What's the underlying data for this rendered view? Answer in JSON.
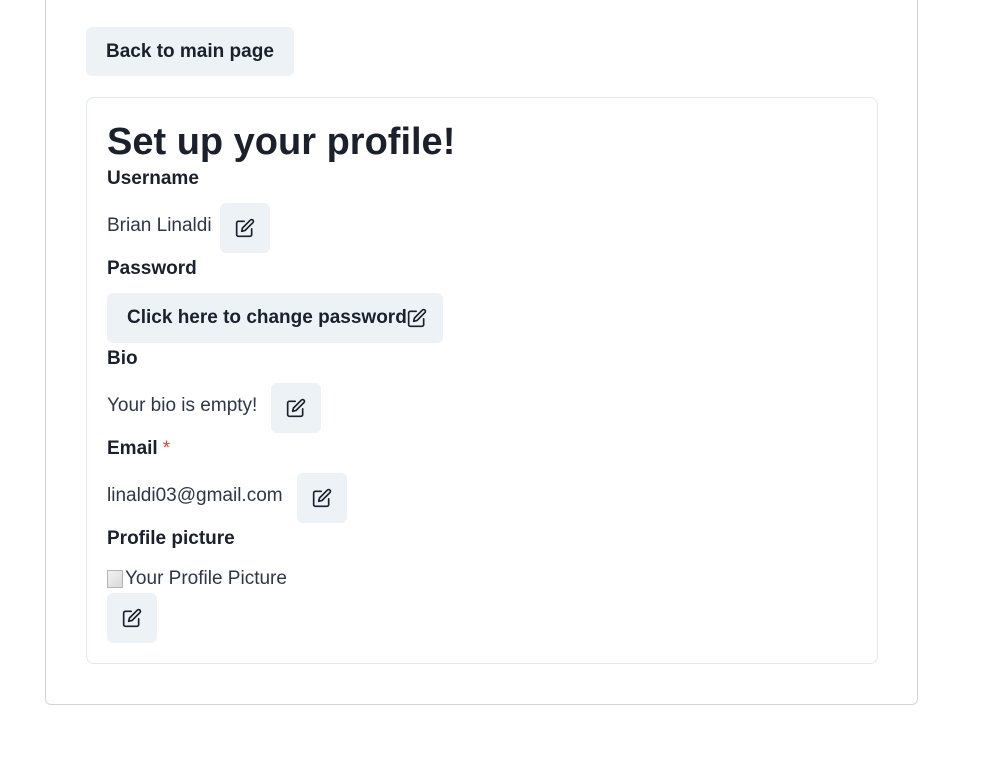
{
  "header": {
    "back_label": "Back to main page"
  },
  "profile": {
    "title": "Set up your profile!",
    "username": {
      "label": "Username",
      "value": "Brian Linaldi"
    },
    "password": {
      "label": "Password",
      "button_label": "Click here to change password"
    },
    "bio": {
      "label": "Bio",
      "value": "Your bio is empty!"
    },
    "email": {
      "label": "Email",
      "required_mark": "*",
      "value": "linaldi03@gmail.com"
    },
    "picture": {
      "label": "Profile picture",
      "alt": "Your Profile Picture"
    }
  },
  "icons": {
    "edit": "edit-icon"
  },
  "colors": {
    "button_bg": "#edf2f7",
    "text": "#1a202c",
    "required": "#e53e3e",
    "border": "#e2e8f0"
  }
}
